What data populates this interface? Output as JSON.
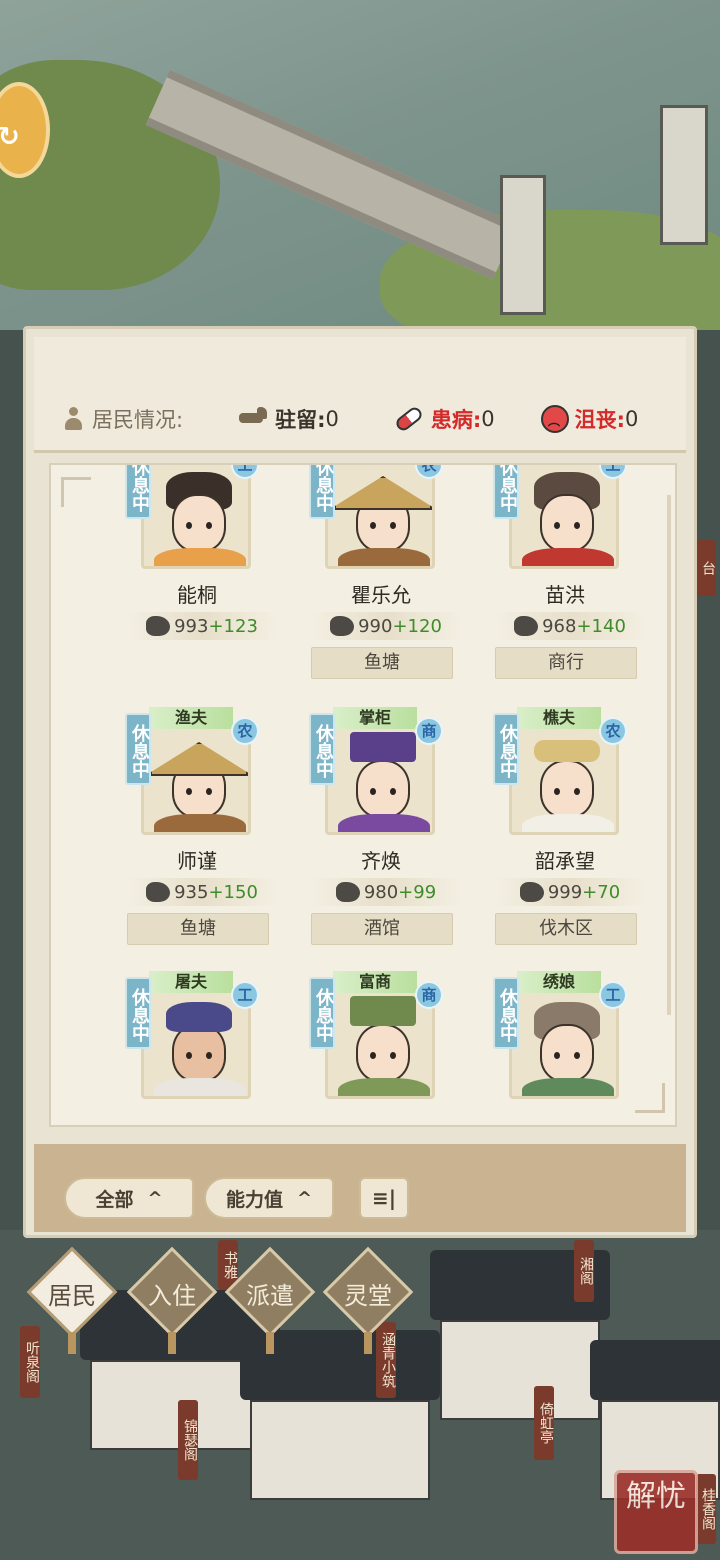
{
  "status_bar": {
    "label": "居民情况:",
    "stationed_label": "驻留:",
    "stationed_value": "0",
    "sick_label": "患病:",
    "sick_value": "0",
    "depressed_label": "沮丧:",
    "depressed_value": "0",
    "colors": {
      "sick": "#d42a2a",
      "depressed": "#d42a2a"
    }
  },
  "residents": [
    {
      "name": "能桐",
      "status": "休息中",
      "type_badge": "工",
      "power_base": "993",
      "power_bonus": "+123",
      "work": ""
    },
    {
      "name": "瞿乐允",
      "status": "休息中",
      "type_badge": "农",
      "power_base": "990",
      "power_bonus": "+120",
      "work": "鱼塘"
    },
    {
      "name": "苗洪",
      "status": "休息中",
      "type_badge": "工",
      "power_base": "968",
      "power_bonus": "+140",
      "work": "商行"
    },
    {
      "name": "师谨",
      "job": "渔夫",
      "status": "休息中",
      "type_badge": "农",
      "power_base": "935",
      "power_bonus": "+150",
      "work": "鱼塘"
    },
    {
      "name": "齐焕",
      "job": "掌柜",
      "status": "休息中",
      "type_badge": "商",
      "power_base": "980",
      "power_bonus": "+99",
      "work": "酒馆"
    },
    {
      "name": "韶承望",
      "job": "樵夫",
      "status": "休息中",
      "type_badge": "农",
      "power_base": "999",
      "power_bonus": "+70",
      "work": "伐木区"
    },
    {
      "job": "屠夫",
      "status": "休息中",
      "type_badge": "工"
    },
    {
      "job": "富商",
      "status": "休息中",
      "type_badge": "商"
    },
    {
      "job": "绣娘",
      "status": "休息中",
      "type_badge": "工"
    }
  ],
  "filters": {
    "all_label": "全部",
    "ability_label": "能力值",
    "sort_label": "≡|",
    "chevron": "^"
  },
  "tabs": [
    {
      "label": "居民",
      "active": true
    },
    {
      "label": "入住",
      "active": false
    },
    {
      "label": "派遣",
      "active": false
    },
    {
      "label": "灵堂",
      "active": false
    }
  ],
  "map_signs": [
    "书雅",
    "湘阁",
    "听泉阁",
    "涵青小筑",
    "锦瑟阁",
    "倚虹亭",
    "桂香阁",
    "台"
  ],
  "seal_text": "解忧"
}
